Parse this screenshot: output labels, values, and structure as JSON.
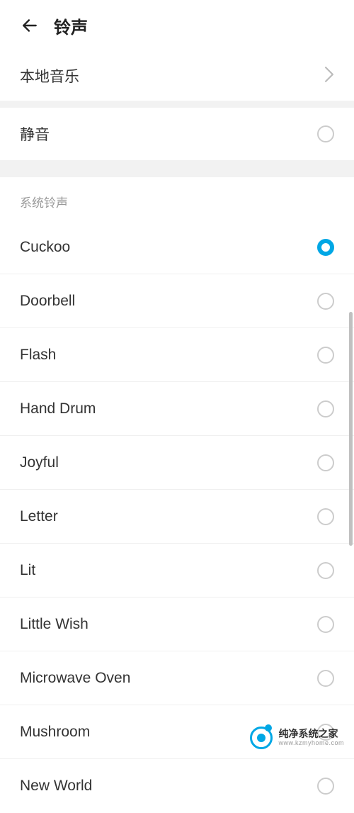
{
  "header": {
    "title": "铃声"
  },
  "localMusic": {
    "label": "本地音乐"
  },
  "silent": {
    "label": "静音",
    "selected": false
  },
  "systemRingtones": {
    "sectionLabel": "系统铃声",
    "items": [
      {
        "label": "Cuckoo",
        "selected": true
      },
      {
        "label": "Doorbell",
        "selected": false
      },
      {
        "label": "Flash",
        "selected": false
      },
      {
        "label": "Hand Drum",
        "selected": false
      },
      {
        "label": "Joyful",
        "selected": false
      },
      {
        "label": "Letter",
        "selected": false
      },
      {
        "label": "Lit",
        "selected": false
      },
      {
        "label": "Little Wish",
        "selected": false
      },
      {
        "label": "Microwave Oven",
        "selected": false
      },
      {
        "label": "Mushroom",
        "selected": false
      },
      {
        "label": "New World",
        "selected": false
      }
    ]
  },
  "watermark": {
    "cn": "纯净系统之家",
    "en": "www.kzmyhome.com"
  }
}
